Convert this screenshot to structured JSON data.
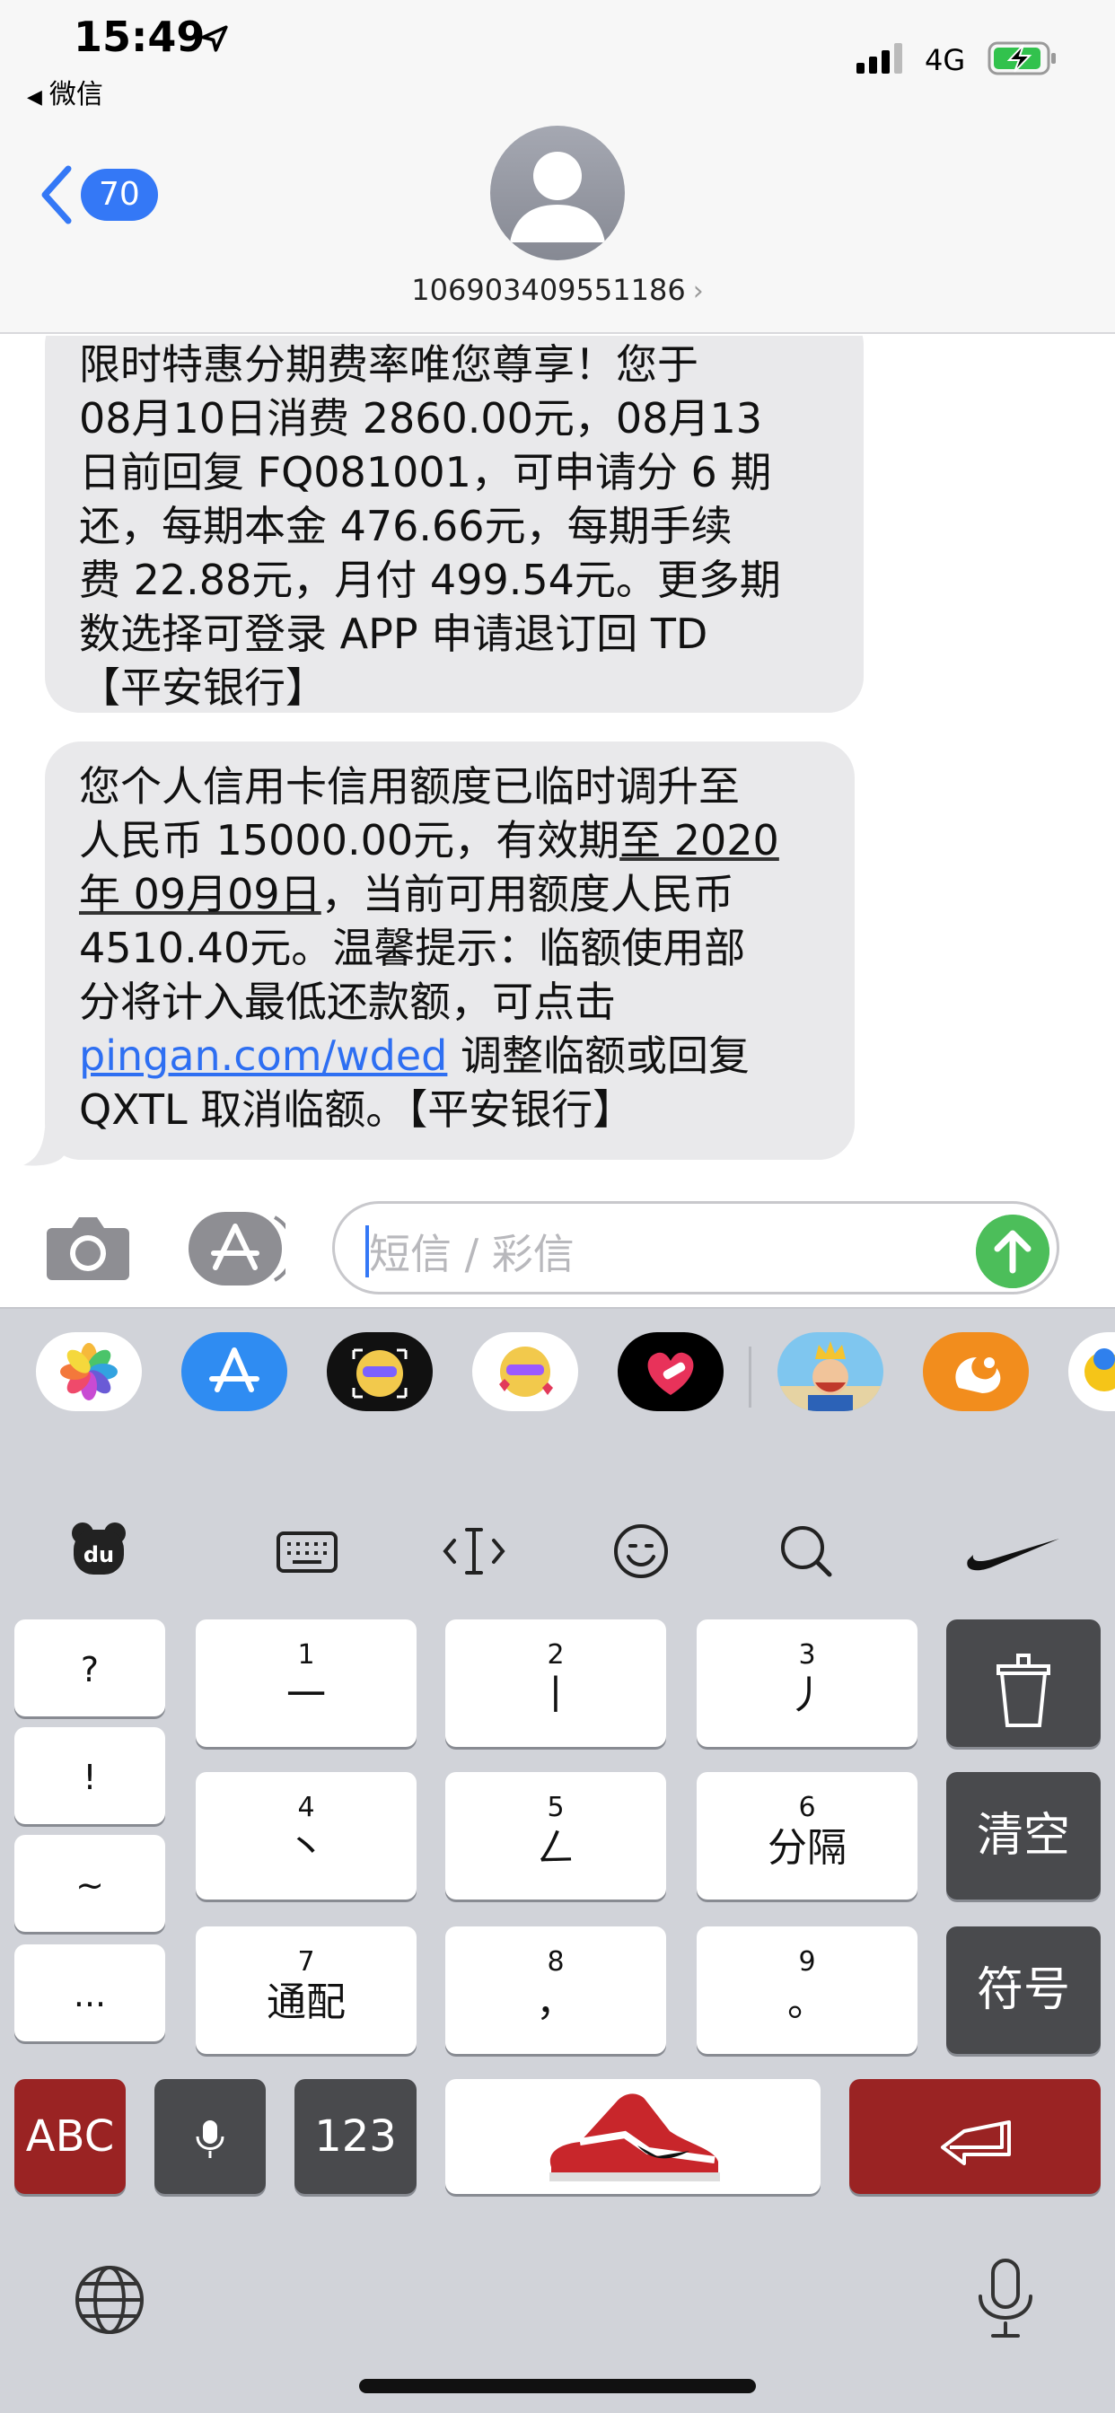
{
  "status_bar": {
    "time": "15:49",
    "back_app": "微信",
    "network": "4G"
  },
  "nav": {
    "unread_count": "70",
    "contact_number": "106903409551186"
  },
  "messages": {
    "m1": {
      "lines": [
        "限时特惠分期费率唯您尊享！您于",
        "08月10日消费 2860.00元，08月13",
        "日前回复 FQ081001，可申请分 6 期",
        "还，每期本金 476.66元，每期手续",
        "费 22.88元，月付 499.54元。更多期",
        "数选择可登录 APP 申请退订回 TD",
        "【平安银行】"
      ]
    },
    "m2": {
      "line1": "您个人信用卡信用额度已临时调升至",
      "line2a": "人民币 15000.00元，有效期",
      "line2b": "至 2020",
      "line3a": "年 09月09日",
      "line3b": "，当前可用额度人民币",
      "line4": "4510.40元。温馨提示：临额使用部",
      "line5": "分将计入最低还款额，可点击",
      "link": "pingan.com/wded",
      "line6b": " 调整临额或回复",
      "line7": "QXTL 取消临额。【平安银行】"
    }
  },
  "input": {
    "placeholder": "短信 / 彩信"
  },
  "keyboard": {
    "left_column": [
      "?",
      "!",
      "~",
      "..."
    ],
    "keys": [
      {
        "num": "1",
        "char": "一"
      },
      {
        "num": "2",
        "char": "丨"
      },
      {
        "num": "3",
        "char": "丿"
      },
      {
        "num": "4",
        "char": "丶"
      },
      {
        "num": "5",
        "char": "ㄥ"
      },
      {
        "num": "6",
        "char": "分隔"
      },
      {
        "num": "7",
        "char": "通配"
      },
      {
        "num": "8",
        "char": "，"
      },
      {
        "num": "9",
        "char": "。"
      }
    ],
    "clear_label": "清空",
    "symbol_label": "符号",
    "abc_label": "ABC",
    "num_label": "123"
  },
  "colors": {
    "accent": "#3478f6",
    "send": "#4cbe5a",
    "bubble": "#e9e9eb",
    "key_red": "#9a2323",
    "key_dark": "#494a4d"
  }
}
